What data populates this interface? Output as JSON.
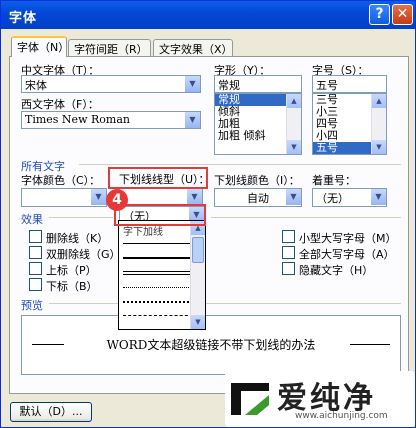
{
  "window": {
    "title": "字体",
    "help_glyph": "?",
    "close_glyph": "✕"
  },
  "tabs": [
    {
      "label": "字体（N）",
      "active": true
    },
    {
      "label": "字符间距（R）",
      "active": false
    },
    {
      "label": "文字效果（X）",
      "active": false
    }
  ],
  "font": {
    "chinese_label": "中文字体（T）：",
    "chinese_value": "宋体",
    "western_label": "西文字体（F）：",
    "western_value": "Times New Roman",
    "style_label": "字形（Y）：",
    "style_value": "常规",
    "style_options": [
      "常规",
      "倾斜",
      "加粗",
      "加粗 倾斜"
    ],
    "size_label": "字号（S）：",
    "size_value": "五号",
    "size_options": [
      "三号",
      "小三",
      "四号",
      "小四",
      "五号"
    ]
  },
  "all_text": {
    "section_label": "所有文字",
    "font_color_label": "字体颜色（C）：",
    "underline_type_label": "下划线线型（U）：",
    "underline_type_value": "（无）",
    "underline_color_label": "下划线颜色（I）：",
    "underline_color_value": "自动",
    "emphasis_label": "着重号：",
    "emphasis_value": "（无）"
  },
  "underline_dropdown": {
    "first_option": "字下加线"
  },
  "effects": {
    "section_label": "效果",
    "left": [
      "删除线（K）",
      "双删除线（G）",
      "上标（P）",
      "下标（B）"
    ],
    "right": [
      "小型大写字母（M）",
      "全部大写字母（A）",
      "隐藏文字（H）"
    ]
  },
  "preview": {
    "section_label": "预览",
    "text": "WORD文本超级链接不带下划线的办法"
  },
  "buttons": {
    "default": "默认（D）..."
  },
  "annotation": {
    "step_number": "4"
  },
  "watermark": {
    "brand": "爱纯净",
    "url": "www.aichunjing.com"
  },
  "colors": {
    "accent_red": "#e23b3b",
    "selection_blue": "#316ac5",
    "titlebar_blue": "#0546d6"
  }
}
